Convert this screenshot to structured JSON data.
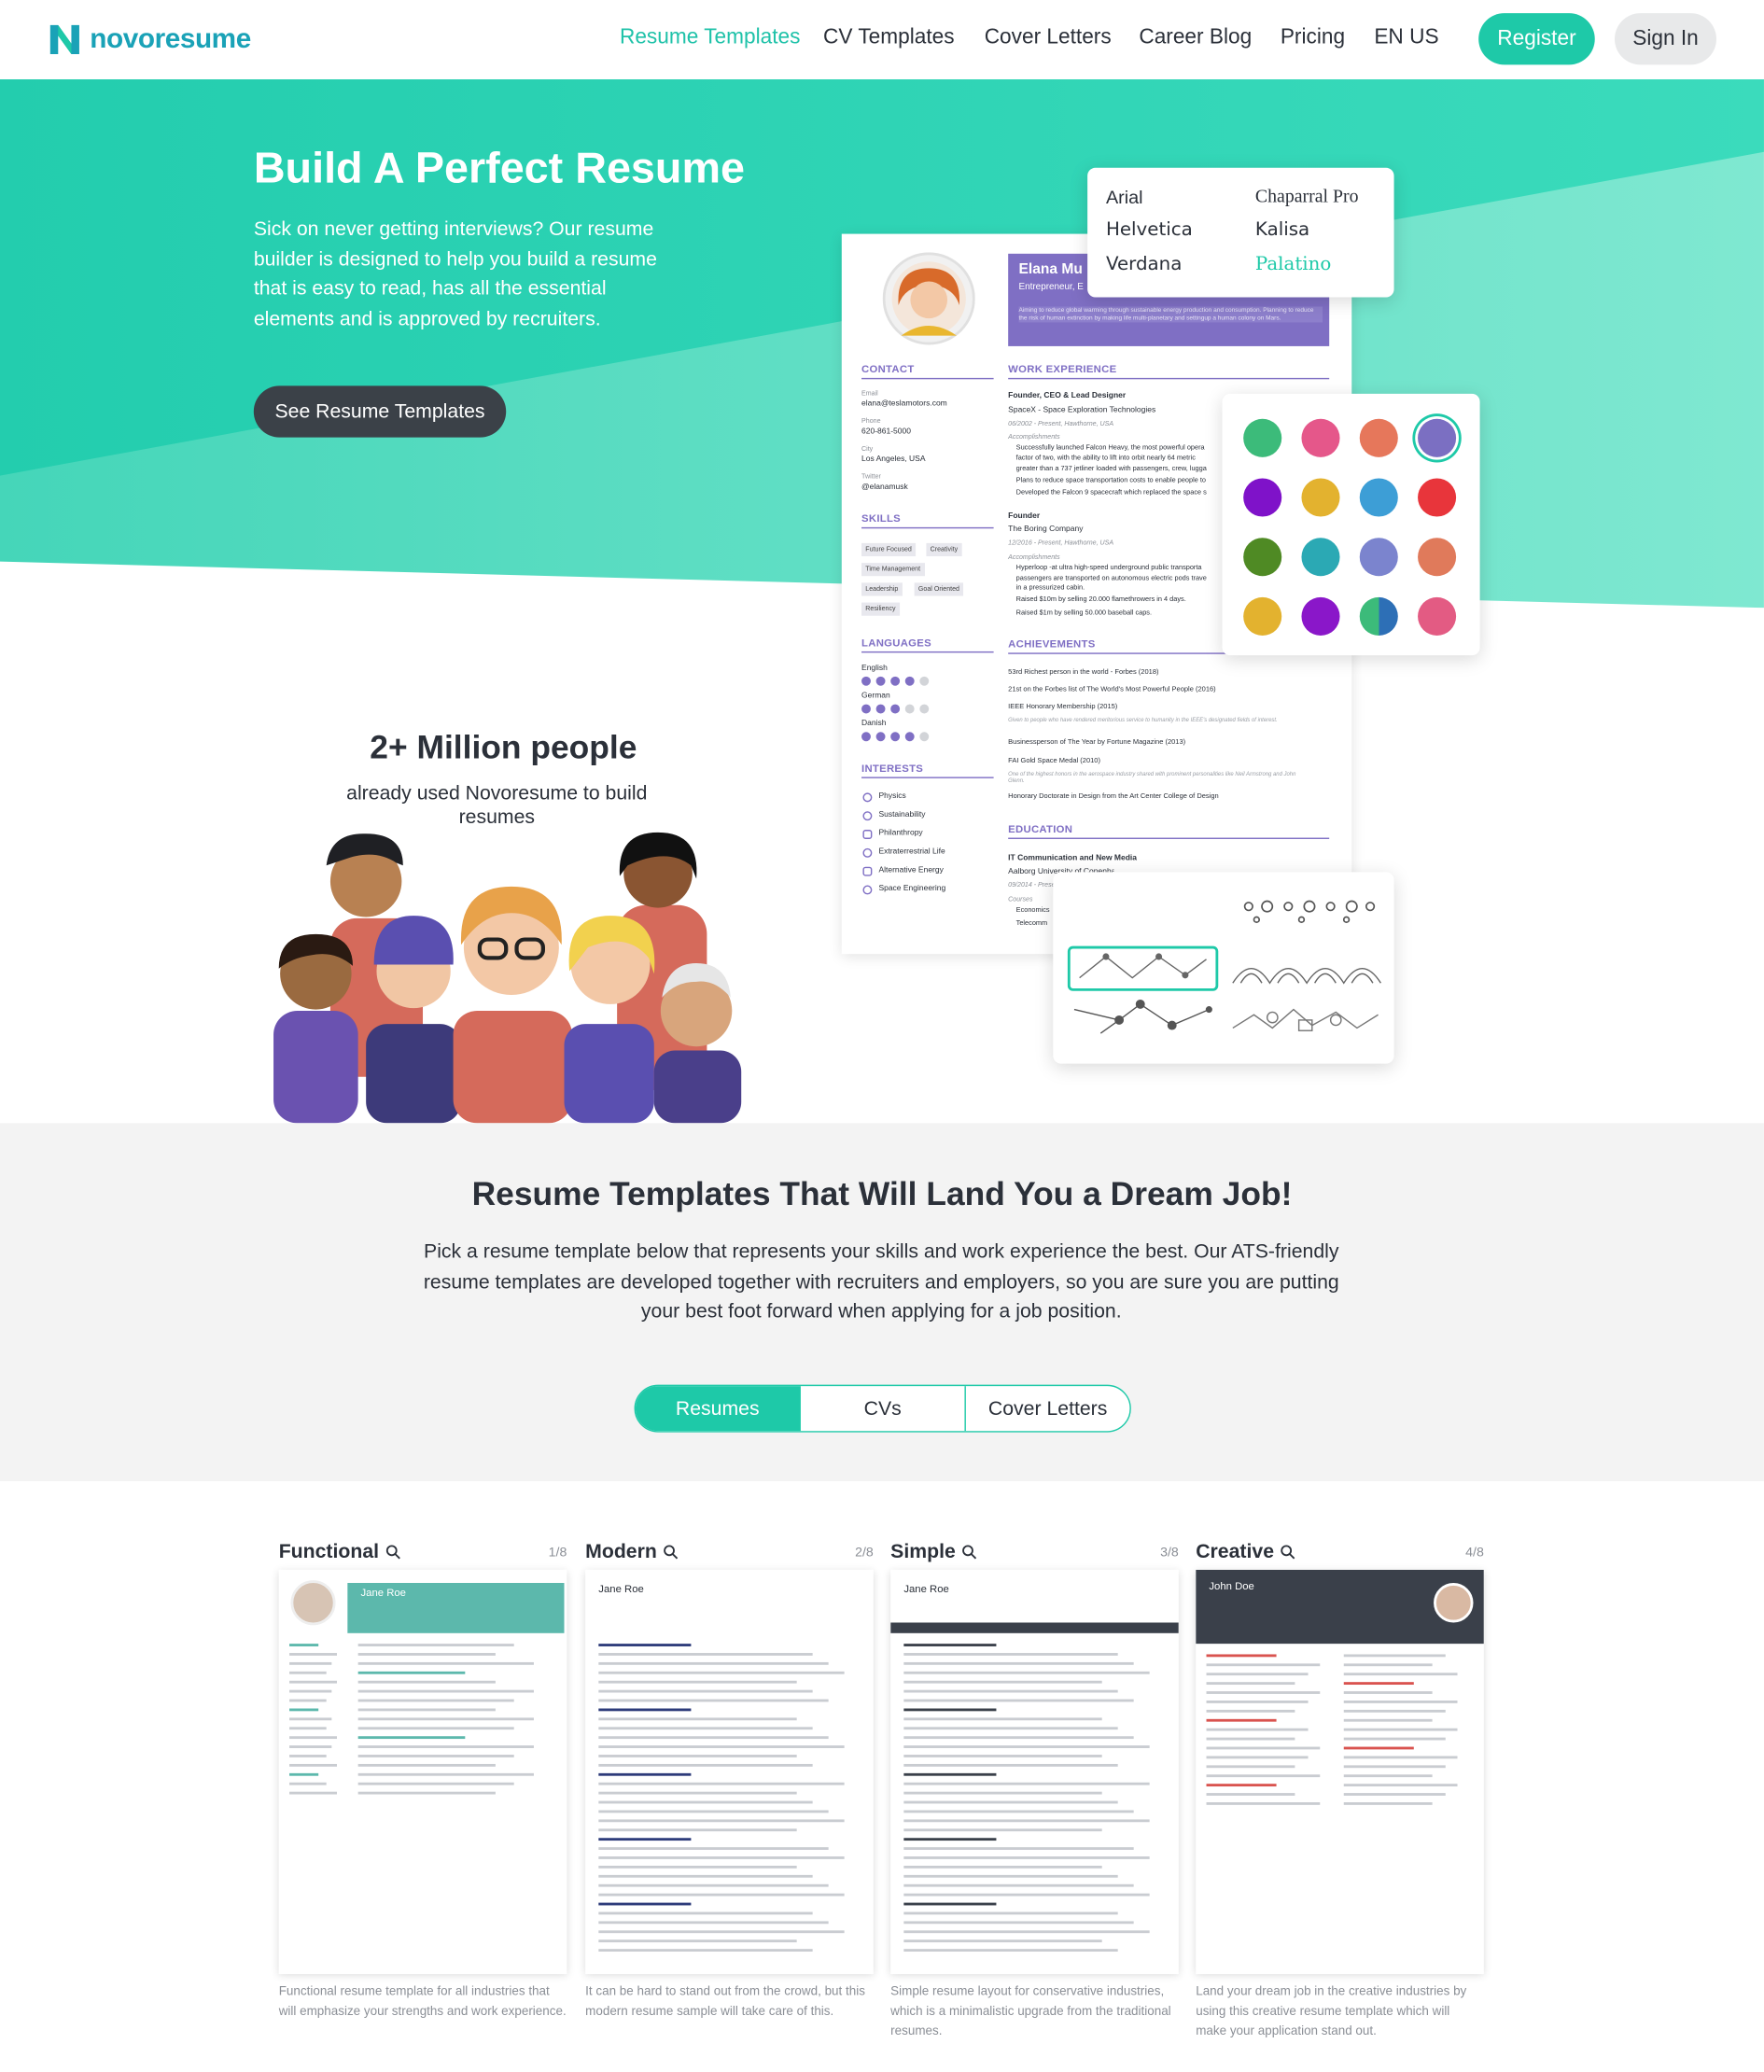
{
  "nav": {
    "brand": "novoresume",
    "items": [
      "Resume Templates",
      "CV Templates",
      "Cover Letters",
      "Career Blog",
      "Pricing",
      "EN US"
    ],
    "register": "Register",
    "sign_in": "Sign In"
  },
  "hero": {
    "title": "Build A Perfect Resume",
    "description": "Sick on never getting interviews? Our resume builder is designed to help you build a resume that is easy to read, has all the essential elements and is approved by recruiters.",
    "cta": "See Resume Templates",
    "stat_title": "2+ Million people",
    "stat_sub": "already used Novoresume to build resumes"
  },
  "preview": {
    "name": "Elana Mu",
    "role": "Entrepreneur, E",
    "summary": "Aiming to reduce global warming through sustainable energy production and consumption. Planning to reduce the risk of human extinction by making life multi-planetary and settingup a human colony on Mars.",
    "contact_h": "CONTACT",
    "contact": [
      {
        "label": "Email",
        "value": "elana@teslamotors.com"
      },
      {
        "label": "Phone",
        "value": "620-861-5000"
      },
      {
        "label": "City",
        "value": "Los Angeles, USA"
      },
      {
        "label": "Twitter",
        "value": "@elanamusk"
      }
    ],
    "skills_h": "SKILLS",
    "skills": [
      "Future Focused",
      "Creativity",
      "Time Management",
      "Leadership",
      "Goal Oriented",
      "Resiliency"
    ],
    "languages_h": "LANGUAGES",
    "languages": [
      {
        "name": "English",
        "level": 4
      },
      {
        "name": "German",
        "level": 3
      },
      {
        "name": "Danish",
        "level": 4
      }
    ],
    "interests_h": "INTERESTS",
    "interests": [
      "Physics",
      "Sustainability",
      "Philanthropy",
      "Extraterrestrial Life",
      "Alternative Energy",
      "Space Engineering"
    ],
    "work_h": "WORK EXPERIENCE",
    "job1_title": "Founder, CEO & Lead Designer",
    "job1_company": "SpaceX - Space Exploration Technologies",
    "job1_dates": "06/2002 - Present, Hawthorne, USA",
    "accomplishments": "Accomplishments",
    "job1_bullets": [
      "Successfully launched Falcon Heavy, the most powerful opera",
      "factor of two, with the ability to lift into orbit nearly 64 metric",
      "greater than a 737 jetliner loaded with passengers, crew, lugga",
      "Plans to reduce space transportation costs to enable people to",
      "Developed the Falcon 9 spacecraft which replaced the space s"
    ],
    "job2_title": "Founder",
    "job2_company": "The Boring Company",
    "job2_dates": "12/2016 - Present, Hawthorne, USA",
    "job2_bullets": [
      "Hyperloop -at ultra high-speed underground public transporta",
      "passengers are transported on autonomous electric pods trave",
      "in a pressurized cabin.",
      "Raised $10m by selling 20.000 flamethrowers in 4 days.",
      "Raised $1m by selling 50.000 baseball caps."
    ],
    "achievements_h": "ACHIEVEMENTS",
    "achievements": [
      "53rd Richest person in the world - Forbes (2018)",
      "21st on the Forbes list of The World's Most Powerful People (2016)",
      "IEEE Honorary Membership (2015)",
      "Given to people who have rendered meritorious service to humanity in the IEEE's designated fields of interest.",
      "Businessperson of The Year by Fortune Magazine (2013)",
      "FAI Gold Space Medal (2010)",
      "One of the highest honors in the aerospace industry shared with prominent personalities like Neil Armstrong and John Glenn.",
      "Honorary Doctorate in Design from the Art Center College of Design"
    ],
    "education_h": "EDUCATION",
    "edu_title": "IT Communication and New Media",
    "edu_school": "Aalborg University of Copenhagen",
    "edu_dates": "09/2014 - Present",
    "courses": "Courses",
    "edu_courses": [
      "Economics",
      "Telecomm"
    ]
  },
  "fonts": {
    "left": [
      "Arial",
      "Helvetica",
      "Verdana"
    ],
    "right": [
      "Chaparral Pro",
      "Kalisa",
      "Palatino"
    ]
  },
  "colors": {
    "swatches": [
      "#3cbb7a",
      "#e5578a",
      "#e6775b",
      "#7b6fc2",
      "#7f12c9",
      "#e3b22f",
      "#3d9ed6",
      "#e8353b",
      "#4f8a24",
      "#2ba9b4",
      "#7b84ce",
      "#e07a5b",
      "#e3b22f",
      "#8a17c9",
      "split",
      "#e35b83"
    ],
    "brand": "#1ec9a8",
    "brand_dark": "#1aa2b7",
    "accent_purple": "#7f6fc4"
  },
  "templates": {
    "title": "Resume Templates That Will Land You a Dream Job!",
    "description": "Pick a resume template below that represents your skills and work experience the best. Our ATS-friendly resume templates are developed together with recruiters and employers, so you are sure you are putting your best foot forward when applying for a job position.",
    "tabs": [
      "Resumes",
      "CVs",
      "Cover Letters"
    ],
    "cards": [
      {
        "name": "Functional",
        "count": "1/8",
        "person": "Jane Roe",
        "desc": "Functional resume template for all industries that will emphasize your strengths and work experience."
      },
      {
        "name": "Modern",
        "count": "2/8",
        "person": "Jane Roe",
        "desc": "It can be hard to stand out from the crowd, but this modern resume sample will take care of this."
      },
      {
        "name": "Simple",
        "count": "3/8",
        "person": "Jane Roe",
        "desc": "Simple resume layout for conservative industries, which is a minimalistic upgrade from the traditional resumes."
      },
      {
        "name": "Creative",
        "count": "4/8",
        "person": "John Doe",
        "desc": "Land your dream job in the creative industries by using this creative resume template which will make your application stand out."
      }
    ]
  }
}
